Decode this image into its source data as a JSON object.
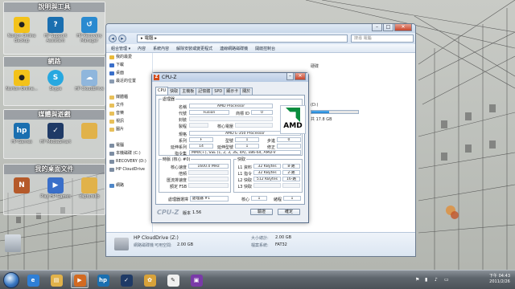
{
  "desktop": {
    "fences": [
      {
        "title": "說明與工具",
        "icons": [
          "Norton Online Backup",
          "HP Support Assistant",
          "HP Recovery Manager"
        ]
      },
      {
        "title": "網路",
        "icons": [
          "Norton Online...",
          "Skype",
          "HP CloudDrive"
        ]
      },
      {
        "title": "媒體與遊戲",
        "icons": [
          "HP Games",
          "HP MediaSmart",
          ""
        ]
      },
      {
        "title": "我的桌面文件",
        "icons": [
          "",
          "Play HP Games",
          "capturelib"
        ]
      }
    ],
    "side_labels": [
      "desktop"
    ]
  },
  "explorer": {
    "address": "▸ 電腦 ▸",
    "search_placeholder": "搜尋 電腦",
    "toolbar": [
      "組合管理 ▾",
      "內容",
      "系統內容",
      "解除安裝或變更程式",
      "連線網路磁碟機",
      "開啟控制台"
    ],
    "nav": [
      {
        "label": "我的最愛",
        "color": "#e8b93a"
      },
      {
        "label": "下載",
        "color": "#3a6fc9"
      },
      {
        "label": "桌面",
        "color": "#3a6fc9"
      },
      {
        "label": "最近的位置",
        "color": "#8a9bb0"
      },
      {
        "label": "",
        "color": ""
      },
      {
        "label": "媒體櫃",
        "color": "#e8c05a"
      },
      {
        "label": "文件",
        "color": "#e8c05a"
      },
      {
        "label": "音樂",
        "color": "#e8c05a"
      },
      {
        "label": "視訊",
        "color": "#e8c05a"
      },
      {
        "label": "圖片",
        "color": "#e8c05a"
      },
      {
        "label": "",
        "color": ""
      },
      {
        "label": "電腦",
        "color": "#7d8da2"
      },
      {
        "label": "本機磁碟 (C:)",
        "color": "#7d8da2"
      },
      {
        "label": "RECOVERY (D:)",
        "color": "#7d8da2"
      },
      {
        "label": "HP CloudDrive",
        "color": "#7d8da2"
      },
      {
        "label": "",
        "color": ""
      },
      {
        "label": "網路",
        "color": "#4f87c8"
      }
    ],
    "section_header": "硬碟",
    "drive_label": "(D:)",
    "drive_free": "共 17.8 GB",
    "drive_usage": 0.38,
    "details": {
      "name": "HP CloudDrive (Z:)",
      "name_label": "網路磁碟機",
      "rows": [
        {
          "label": "可用空間:",
          "value": "2.00 GB"
        },
        {
          "label": "大小總計:",
          "value": "2.00 GB"
        },
        {
          "label": "檔案系統:",
          "value": "FAT32"
        }
      ]
    }
  },
  "cpuz": {
    "title": "CPU-Z",
    "tabs": [
      "CPU",
      "快取",
      "主機板",
      "記憶體",
      "SPD",
      "顯示卡",
      "關於"
    ],
    "processor_group": "處理器",
    "fields": {
      "name_label": "名稱",
      "name": "AMD Processor",
      "codename_label": "代號",
      "codename": "Fusion",
      "brand_label": "商標 ID",
      "brand": "0",
      "package_label": "封裝",
      "package": "",
      "tech_label": "製程",
      "tech": "",
      "voltage_label": "核心電壓",
      "voltage": "",
      "spec_label": "規格",
      "spec": "AMD E-350 Processor",
      "family_label": "系列",
      "family": "F",
      "model_label": "型號",
      "model": "1",
      "stepping_label": "步進",
      "stepping": "0",
      "extfamily_label": "延伸系列",
      "extfamily": "14",
      "extmodel_label": "延伸型號",
      "extmodel": "1",
      "revision_label": "修正",
      "revision": "",
      "instr_label": "指令集",
      "instr": "MMX(+), SSE (1, 2, 3, 3S, 4A), x86-64, AMD-V"
    },
    "clocks_group": "時脈 (核心 #0)",
    "clocks": {
      "core_label": "核心速度",
      "core": "1600.0 MHz",
      "mult_label": "倍頻",
      "mult": "",
      "bus_label": "匯流排速度",
      "bus": "",
      "fsb_label": "額定 FSB",
      "fsb": ""
    },
    "cache_group": "快取",
    "cache": [
      {
        "label": "L1 資料",
        "value": "32 KBytes",
        "way": "8-路"
      },
      {
        "label": "L1 指令",
        "value": "32 KBytes",
        "way": "2-路"
      },
      {
        "label": "L2 快取",
        "value": "512 KBytes",
        "way": "16-路"
      },
      {
        "label": "L3 快取",
        "value": "",
        "way": ""
      }
    ],
    "selection_label": "處理器選擇",
    "selection_value": "處理器 #1",
    "cores_label": "核心",
    "cores": "1",
    "threads_label": "緒程",
    "threads": "1",
    "brand_footer": "CPU-Z",
    "version_label": "版本",
    "version": "1.56",
    "validate": "驗證",
    "ok": "確定"
  },
  "taskbar": {
    "apps": [
      {
        "name": "ie",
        "color": "#2f7fd6",
        "glyph": "e"
      },
      {
        "name": "explorer",
        "color": "#e1b24a",
        "glyph": "▤"
      },
      {
        "name": "media",
        "color": "#d26a22",
        "glyph": "▶"
      },
      {
        "name": "hp",
        "color": "#1a6fb0",
        "glyph": "hp"
      },
      {
        "name": "mediasmart",
        "color": "#1f3a66",
        "glyph": "✓"
      },
      {
        "name": "messenger",
        "color": "#d8a23a",
        "glyph": "✿"
      },
      {
        "name": "paint",
        "color": "#f0f0f0",
        "glyph": "✎"
      },
      {
        "name": "cpuz",
        "color": "#7a3aa8",
        "glyph": "▣"
      }
    ],
    "active_index": 2,
    "clock_time": "下午 04:43",
    "clock_date": "2011/2/26"
  }
}
